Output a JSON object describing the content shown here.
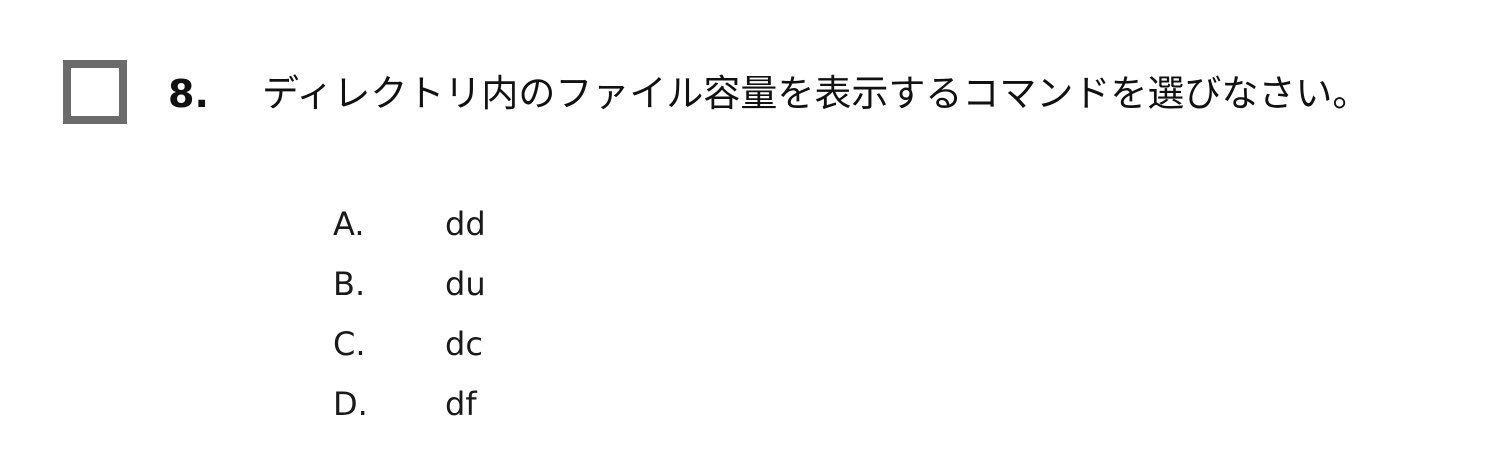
{
  "question": {
    "number": "8.",
    "text": "ディレクトリ内のファイル容量を表示するコマンドを選びなさい。"
  },
  "options": [
    {
      "letter": "A.",
      "text": "dd"
    },
    {
      "letter": "B.",
      "text": "du"
    },
    {
      "letter": "C.",
      "text": "dc"
    },
    {
      "letter": "D.",
      "text": "df"
    }
  ]
}
